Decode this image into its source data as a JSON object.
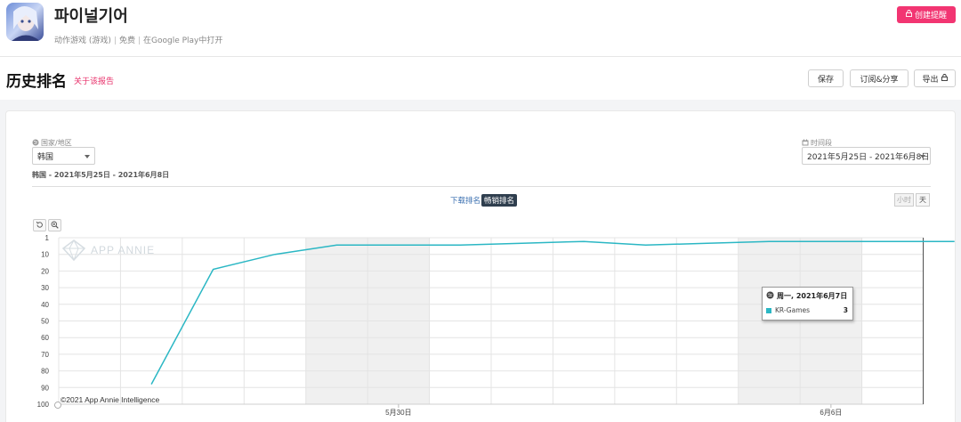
{
  "app": {
    "name": "파이널기어",
    "category": "动作游戏 (游戏)",
    "price": "免费",
    "store_link": "在Google Play中打开",
    "alert_button": "创建提醒"
  },
  "section": {
    "title": "历史排名",
    "about_link": "关于该报告",
    "save_button": "保存",
    "subscribe_button": "订阅&分享",
    "export_button": "导出"
  },
  "filters": {
    "country_label": "国家/地区",
    "country_value": "韩国",
    "period_label": "时间段",
    "period_value": "2021年5月25日 - 2021年6月8日",
    "summary": "韩国 - 2021年5月25日 - 2021年6月8日"
  },
  "rank_tabs": {
    "downloads": "下载排名",
    "grossing": "畅销排名"
  },
  "granularity": {
    "hour": "小时",
    "day": "天"
  },
  "colors": {
    "accent": "#f23572",
    "series": "#2bb7c4",
    "weekend_band": "#f0f0f0"
  },
  "chart_data": {
    "type": "line",
    "y_axis": {
      "inverted": true,
      "ticks": [
        "1",
        "10",
        "20",
        "30",
        "40",
        "50",
        "60",
        "70",
        "80",
        "90",
        "100"
      ],
      "tick_values": [
        1,
        10,
        20,
        30,
        40,
        50,
        60,
        70,
        80,
        90,
        100
      ],
      "ylim": [
        1,
        100
      ]
    },
    "x_axis": {
      "tick_labels": [
        "5月30日",
        "6月6日"
      ]
    },
    "x": [
      "2021-05-25",
      "2021-05-26",
      "2021-05-27",
      "2021-05-28",
      "2021-05-29",
      "2021-05-30",
      "2021-05-31",
      "2021-06-01",
      "2021-06-02",
      "2021-06-03",
      "2021-06-04",
      "2021-06-05",
      "2021-06-06",
      "2021-06-07",
      "2021-06-08"
    ],
    "series": [
      {
        "name": "KR-Games",
        "values": [
          null,
          88,
          19,
          10,
          5,
          5,
          5,
          4,
          3,
          5,
          4,
          3,
          3,
          3,
          3
        ]
      }
    ],
    "weekends": [
      [
        "2021-05-29",
        "2021-05-30"
      ],
      [
        "2021-06-05",
        "2021-06-06"
      ]
    ],
    "watermark": "APP ANNIE",
    "copyright": "©2021 App Annie Intelligence",
    "grid": true
  },
  "tooltip": {
    "date": "周一, 2021年6月7日",
    "series": "KR-Games",
    "value": "3"
  }
}
